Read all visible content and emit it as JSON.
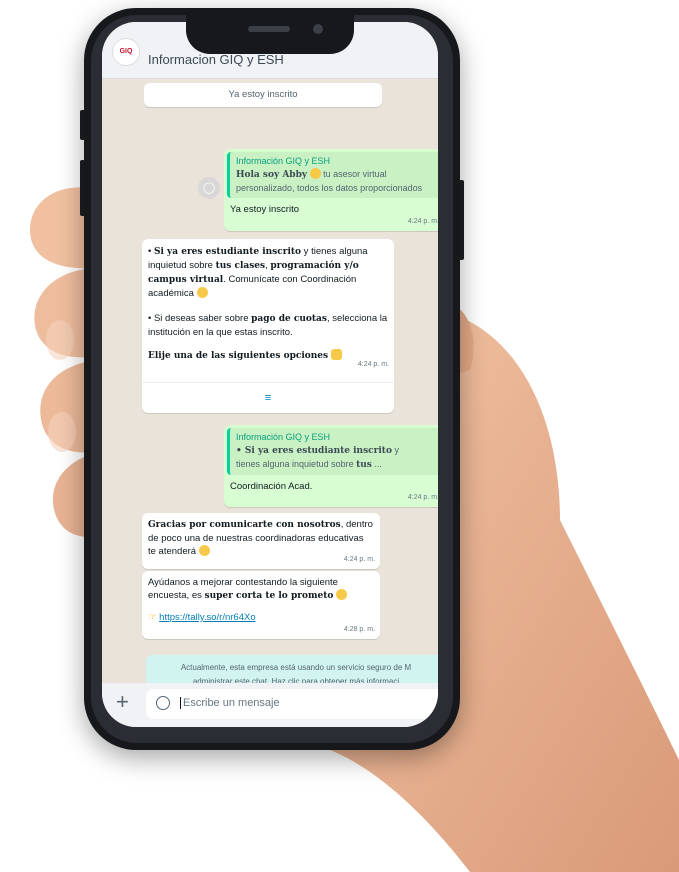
{
  "header": {
    "title": "Informacion GIQ y ESH",
    "avatar_text": "GIQ"
  },
  "messages": {
    "top_button": "Ya estoy inscrito",
    "reply1": {
      "quote_name": "Información GIQ y ESH",
      "quote_bold": "Hola soy Abby",
      "quote_rest": " tu asesor virtual",
      "quote_line2": "personalizado, todos los datos proporcionados",
      "text": "Ya estoy inscrito",
      "time": "4:24 p. m."
    },
    "info": {
      "p1_bullet": "• ",
      "p1_b1": "Si ya eres estudiante inscrito",
      "p1_t1": " y tienes alguna inquietud sobre ",
      "p1_b2": "tus clases",
      "p1_t2": ", ",
      "p1_b3": "programación y/o campus virtual",
      "p1_t3": ". Comunícate con Coordinación académica",
      "p2_bullet": "• Si deseas saber sobre ",
      "p2_b": "pago de cuotas",
      "p2_t": ", selecciona la institución en la que estas inscrito.",
      "p3_b": "Elije una de las siguientes opciones",
      "time": "4:24 p. m.",
      "list_icon": "≡"
    },
    "reply2": {
      "quote_name": "Información GIQ y ESH",
      "quote_b": "• Si ya eres estudiante inscrito",
      "quote_t": " y",
      "quote_line2": "tienes alguna inquietud sobre ",
      "quote_line2_b": "tus",
      "quote_line2_end": " ...",
      "text": "Coordinación Acad.",
      "time": "4:24 p. m."
    },
    "thanks": {
      "b": "Gracias por comunicarte con nosotros",
      "t": ", dentro de poco una de nuestras coordinadoras educativas te atenderá",
      "time": "4:24 p. m."
    },
    "survey": {
      "t1": "Ayúdanos a mejorar contestando la siguiente encuesta, es ",
      "b": "super corta te lo prometo",
      "link": "https://tally.so/r/nr64Xo",
      "time": "4:28 p. m."
    },
    "notice_line1": "Actualmente, esta empresa está usando un servicio seguro de M",
    "notice_line2": "administrar este chat. Haz clic para obtener más informaci"
  },
  "footer": {
    "placeholder": "Escribe un mensaje",
    "plus": "+"
  }
}
